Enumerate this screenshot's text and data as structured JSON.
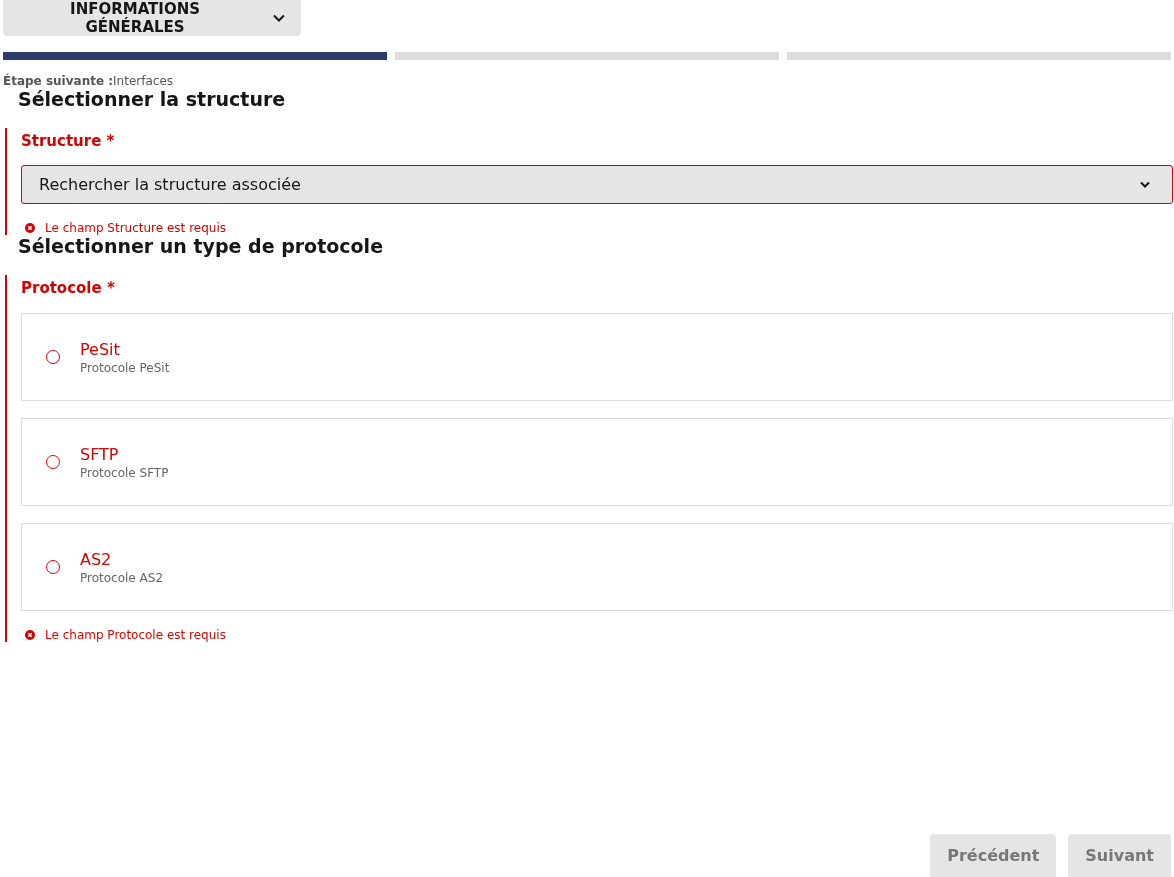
{
  "step_menu": {
    "label": "INFORMATIONS GÉNÉRALES",
    "expanded": false
  },
  "progress": [
    {
      "done": true
    },
    {
      "done": false
    },
    {
      "done": false
    }
  ],
  "next_step": {
    "label": "Étape suivante :",
    "value": "Interfaces"
  },
  "sections": [
    {
      "kind": "select",
      "title": "Sélectionner la structure",
      "label": "Structure *",
      "error": true,
      "placeholder": "Rechercher la structure associée",
      "error_message": "Le champ Structure est requis"
    },
    {
      "kind": "radio",
      "title": "Sélectionner un type de protocole",
      "label": "Protocole *",
      "error": true,
      "options": [
        {
          "label": "PeSit",
          "hint": "Protocole PeSit",
          "selected": false
        },
        {
          "label": "SFTP",
          "hint": "Protocole SFTP",
          "selected": false
        },
        {
          "label": "AS2",
          "hint": "Protocole AS2",
          "selected": false
        }
      ],
      "error_message": "Le champ Protocole est requis"
    }
  ],
  "buttons": [
    {
      "label": "Précédent",
      "disabled": true
    },
    {
      "label": "Suivant",
      "disabled": true
    }
  ]
}
